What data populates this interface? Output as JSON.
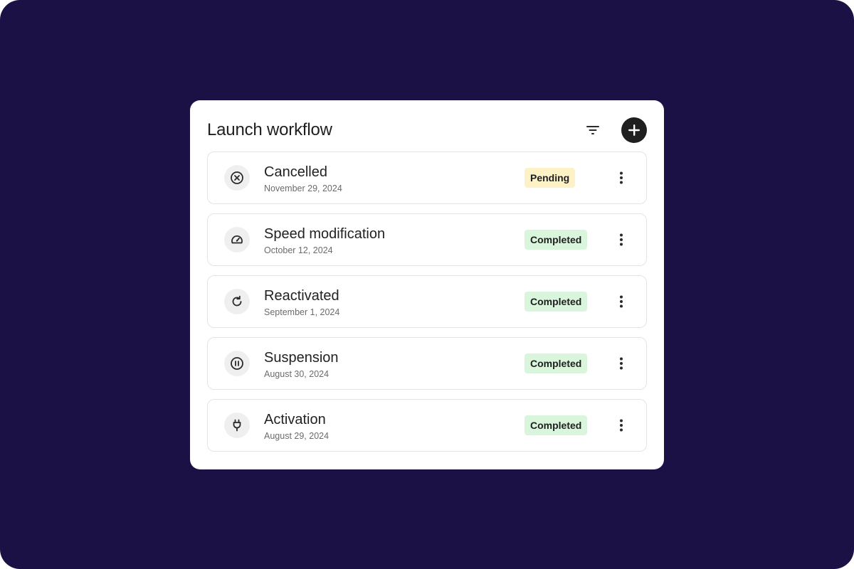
{
  "card": {
    "title": "Launch workflow"
  },
  "toolbar": {
    "filter_icon": "filter-icon",
    "add_icon": "plus-icon"
  },
  "colors": {
    "background": "#1b1145",
    "card": "#ffffff",
    "pending_badge": "#fdf2c6",
    "completed_badge": "#d9f5dc",
    "primary": "#1f1f1f"
  },
  "items": [
    {
      "title": "Cancelled",
      "date": "November 29, 2024",
      "status": "Pending",
      "icon": "cancel-circle-icon"
    },
    {
      "title": "Speed modification",
      "date": "October 12, 2024",
      "status": "Completed",
      "icon": "gauge-icon"
    },
    {
      "title": "Reactivated",
      "date": "September 1, 2024",
      "status": "Completed",
      "icon": "refresh-icon"
    },
    {
      "title": "Suspension",
      "date": "August 30, 2024",
      "status": "Completed",
      "icon": "pause-circle-icon"
    },
    {
      "title": "Activation",
      "date": "August 29, 2024",
      "status": "Completed",
      "icon": "plug-icon"
    }
  ]
}
